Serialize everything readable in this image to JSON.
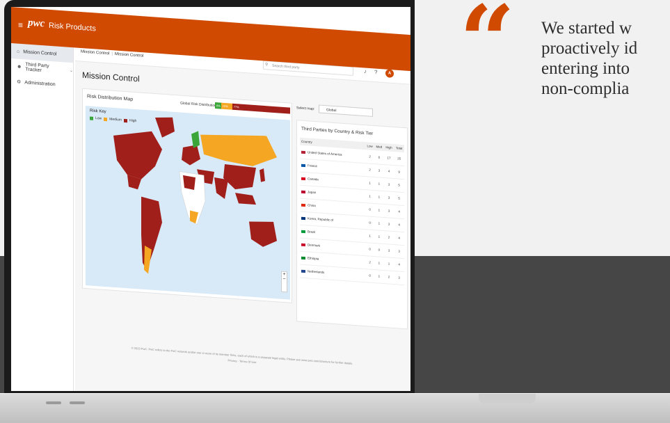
{
  "quote": {
    "mark": "“",
    "lines": [
      "We started w",
      "proactively id",
      "entering into",
      "non-complia"
    ]
  },
  "app": {
    "brand_logo": "pwc",
    "brand_name": "Risk Products",
    "accent_color": "#d04a02"
  },
  "sidebar": {
    "items": [
      {
        "label": "Mission Control",
        "icon": "home-icon",
        "active": true
      },
      {
        "label": "Third Party Tracker",
        "icon": "users-icon",
        "active": false
      },
      {
        "label": "Administration",
        "icon": "gear-icon",
        "active": false
      }
    ]
  },
  "topbar": {
    "breadcrumb": [
      "Mission Control",
      "Mission Control"
    ],
    "search_placeholder": "Search third party",
    "avatar_initial": "A"
  },
  "page": {
    "title": "Mission Control"
  },
  "map_card": {
    "title": "Risk Distribution Map",
    "risk_distribution_label": "Global Risk Distribution:",
    "segments": [
      {
        "label": "8%",
        "value": 8,
        "color": "#3aa639"
      },
      {
        "label": "15%",
        "value": 15,
        "color": "#f5a623"
      },
      {
        "label": "77%",
        "value": 77,
        "color": "#a01f1a"
      }
    ],
    "risk_key_title": "Risk Key",
    "risk_key": [
      {
        "label": "Low",
        "color": "#3aa639"
      },
      {
        "label": "Medium",
        "color": "#f5a623"
      },
      {
        "label": "High",
        "color": "#a01f1a"
      }
    ],
    "zoom_in": "+",
    "zoom_out": "−"
  },
  "table_card": {
    "select_label": "Select map:",
    "select_value": "Global",
    "title": "Third Parties by Country & Risk Tier",
    "columns": [
      "Country",
      "Low",
      "Med",
      "High",
      "Total"
    ],
    "rows": [
      {
        "country": "United States of America",
        "low": "2",
        "med": "6",
        "high": "17",
        "total": "25",
        "flag": "#b22234"
      },
      {
        "country": "France",
        "low": "2",
        "med": "3",
        "high": "4",
        "total": "9",
        "flag": "#0055a4"
      },
      {
        "country": "Canada",
        "low": "1",
        "med": "1",
        "high": "3",
        "total": "5",
        "flag": "#d80621"
      },
      {
        "country": "Japan",
        "low": "1",
        "med": "1",
        "high": "3",
        "total": "5",
        "flag": "#bc002d"
      },
      {
        "country": "China",
        "low": "0",
        "med": "1",
        "high": "3",
        "total": "4",
        "flag": "#de2910"
      },
      {
        "country": "Korea, Republic of",
        "low": "0",
        "med": "1",
        "high": "3",
        "total": "4",
        "flag": "#003478"
      },
      {
        "country": "Brazil",
        "low": "1",
        "med": "1",
        "high": "2",
        "total": "4",
        "flag": "#009c3b"
      },
      {
        "country": "Denmark",
        "low": "0",
        "med": "0",
        "high": "3",
        "total": "3",
        "flag": "#c8102e"
      },
      {
        "country": "Ethiopia",
        "low": "2",
        "med": "1",
        "high": "1",
        "total": "4",
        "flag": "#078930"
      },
      {
        "country": "Netherlands",
        "low": "0",
        "med": "1",
        "high": "2",
        "total": "3",
        "flag": "#21468b"
      }
    ]
  },
  "footer": {
    "text": "© 2023 PwC. PwC refers to the PwC network and/or one or more of its member firms, each of which is a separate legal entity. Please see www.pwc.com/structure for further details.",
    "links": "Privacy  ·  Terms Of Use"
  }
}
